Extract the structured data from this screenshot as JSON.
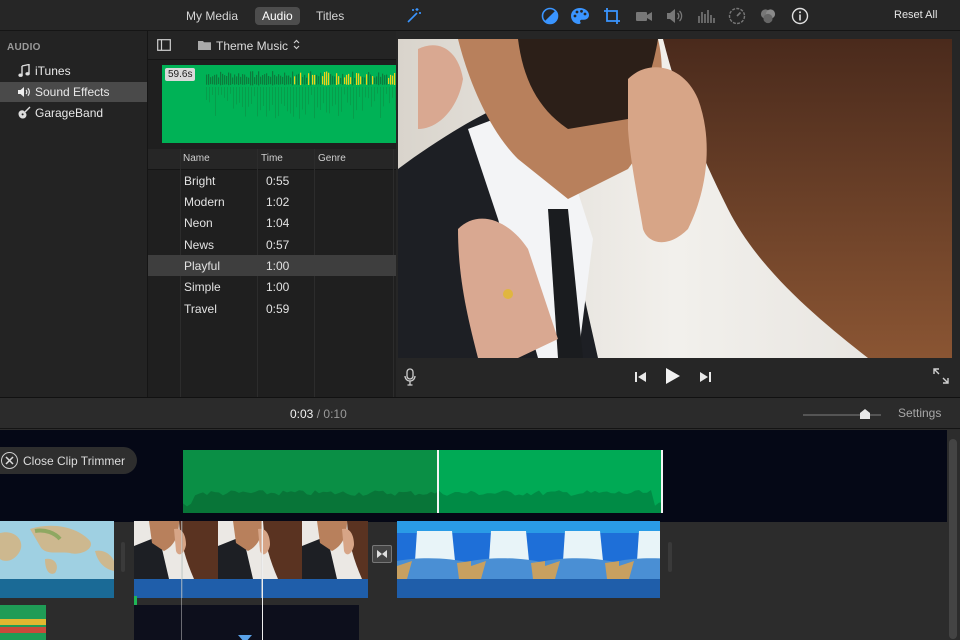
{
  "topbar": {
    "tabs": [
      {
        "label": "My Media",
        "active": false
      },
      {
        "label": "Audio",
        "active": true
      },
      {
        "label": "Titles",
        "active": false
      }
    ],
    "tools": [
      "magic-wand-icon",
      "color-balance-icon",
      "color-palette-icon",
      "crop-icon",
      "stabilization-icon",
      "volume-icon",
      "equalizer-icon",
      "speed-icon",
      "clip-filter-icon",
      "info-icon"
    ],
    "reset_all": "Reset All",
    "accent": "#2e8fff"
  },
  "sidebar": {
    "heading": "AUDIO",
    "items": [
      {
        "label": "iTunes",
        "icon": "music-note-icon",
        "selected": false
      },
      {
        "label": "Sound Effects",
        "icon": "speaker-icon",
        "selected": true
      },
      {
        "label": "GarageBand",
        "icon": "guitar-icon",
        "selected": false
      }
    ]
  },
  "browser": {
    "source_select": "Theme Music",
    "preview_duration": "59.6s",
    "columns": [
      "Name",
      "Time",
      "Genre"
    ],
    "rows": [
      {
        "name": "Bright",
        "time": "0:55",
        "genre": "",
        "selected": false
      },
      {
        "name": "Modern",
        "time": "1:02",
        "genre": "",
        "selected": false
      },
      {
        "name": "Neon",
        "time": "1:04",
        "genre": "",
        "selected": false
      },
      {
        "name": "News",
        "time": "0:57",
        "genre": "",
        "selected": false
      },
      {
        "name": "Playful",
        "time": "1:00",
        "genre": "",
        "selected": true
      },
      {
        "name": "Simple",
        "time": "1:00",
        "genre": "",
        "selected": false
      },
      {
        "name": "Travel",
        "time": "0:59",
        "genre": "",
        "selected": false
      }
    ]
  },
  "viewer": {
    "controls": [
      "microphone-icon",
      "skip-back-icon",
      "play-icon",
      "skip-forward-icon",
      "fullscreen-icon"
    ]
  },
  "timeline": {
    "current_time": "0:03",
    "separator": "/",
    "total_time": "0:10",
    "settings_label": "Settings",
    "close_trimmer_label": "Close Clip Trimmer",
    "audio_color": "#00aa55",
    "video_clip_color": "#1f5eaa"
  }
}
